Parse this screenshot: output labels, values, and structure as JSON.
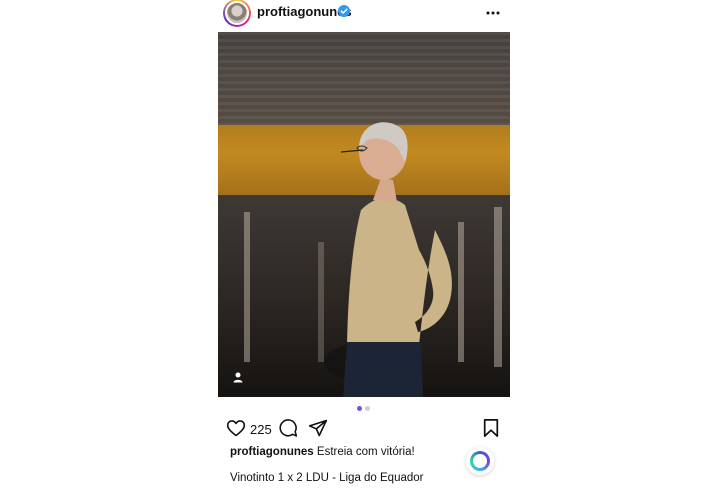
{
  "post": {
    "username": "proftiagonunes",
    "verified": true,
    "verified_icon": "verified-badge-icon",
    "more_icon": "more-options-icon",
    "likes": "225",
    "caption_user": "proftiagonunes",
    "caption_text": "Estreia com vitória!",
    "caption_line2": "Vinotinto 1 x 2 LDU - Liga do Equador",
    "carousel_total": 2,
    "carousel_current": 1
  },
  "icons": {
    "like": "heart-icon",
    "comment": "comment-bubble-icon",
    "share": "send-paper-plane-icon",
    "save": "bookmark-icon",
    "tag": "user-tag-icon",
    "assistant": "ai-assistant-ring-icon"
  },
  "colors": {
    "verified": "#3797f0",
    "dot_active": "#6a5bd8",
    "dot_inactive": "#cfcfcf"
  }
}
